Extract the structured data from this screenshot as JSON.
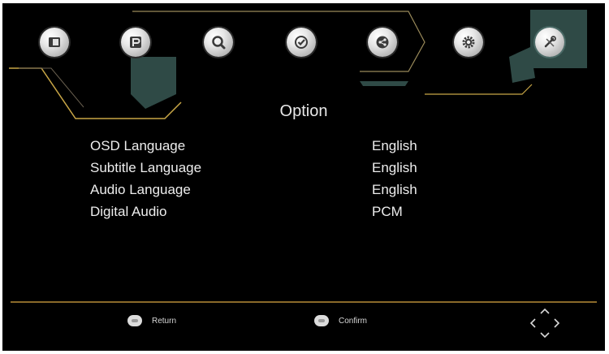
{
  "menu_bar": {
    "items": [
      {
        "id": "picture",
        "icon": "picture-icon"
      },
      {
        "id": "program",
        "icon": "program-p-icon"
      },
      {
        "id": "search",
        "icon": "search-icon"
      },
      {
        "id": "timer",
        "icon": "clock-check-icon"
      },
      {
        "id": "network",
        "icon": "share-nodes-icon"
      },
      {
        "id": "settings",
        "icon": "gear-icon"
      },
      {
        "id": "option",
        "icon": "tools-icon",
        "selected": true
      }
    ]
  },
  "menu": {
    "title": "Option",
    "rows": [
      {
        "label": "OSD Language",
        "value": "English"
      },
      {
        "label": "Subtitle Language",
        "value": "English"
      },
      {
        "label": "Audio Language",
        "value": "English"
      },
      {
        "label": "Digital Audio",
        "value": "PCM"
      }
    ]
  },
  "footer": {
    "return_label": "Return",
    "confirm_label": "Confirm"
  },
  "colors": {
    "background": "#000000",
    "accent_gold": "#c8a646",
    "accent_teal": "#2f4a46",
    "text": "#ededed"
  }
}
